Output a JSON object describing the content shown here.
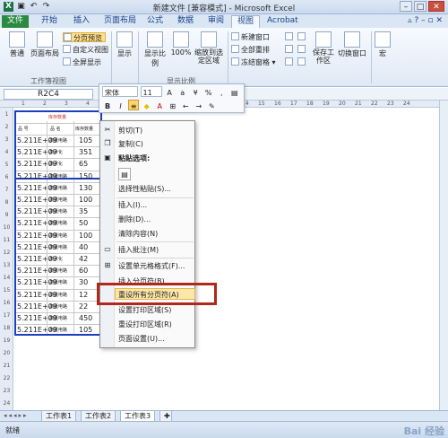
{
  "window": {
    "title": "新建文件 [兼容模式] - Microsoft Excel",
    "qat_icons": [
      "excel-logo-icon",
      "save-icon",
      "undo-icon",
      "redo-icon"
    ],
    "controls": [
      "minimize",
      "maximize",
      "close"
    ]
  },
  "ribbon_tabs": [
    "文件",
    "开始",
    "插入",
    "页面布局",
    "公式",
    "数据",
    "审阅",
    "视图",
    "Acrobat"
  ],
  "active_tab": "视图",
  "ribbon": {
    "workbook_views": {
      "normal": "普通",
      "page_layout": "页面布局",
      "page_break_preview": "分页预览",
      "custom_views": "自定义视图",
      "full_screen": "全屏显示",
      "group_label": "工作簿视图"
    },
    "show": {
      "label": "显示"
    },
    "zoom": {
      "zoom": "显示比例",
      "hundred": "100%",
      "zoom_to_selection": "缩放到选定区域",
      "group_label": "显示比例"
    },
    "window": {
      "new_window": "新建窗口",
      "arrange_all": "全部重排",
      "freeze_panes": "冻结窗格",
      "save_workspace": "保存工作区",
      "switch_windows": "切换窗口"
    },
    "macros": {
      "label": "宏"
    }
  },
  "formula_bar": {
    "name_box": "R2C4"
  },
  "mini_toolbar": {
    "font": "宋体",
    "size": "11",
    "bold": "B",
    "italic": "I",
    "percent": "%"
  },
  "context_menu": {
    "items": [
      "剪切(T)",
      "复制(C)",
      "粘贴选项:",
      "选择性粘贴(S)...",
      "插入(I)...",
      "删除(D)...",
      "清除内容(N)",
      "插入批注(M)",
      "设置单元格格式(F)...",
      "插入分页符(B)",
      "重设所有分页符(A)",
      "设置打印区域(S)",
      "重设打印区域(R)",
      "页面设置(U)..."
    ],
    "highlighted": "重设所有分页符(A)",
    "highlight_color": "#b0281c"
  },
  "sheet": {
    "column_headers": [
      "1",
      "2",
      "3",
      "4",
      "5",
      "6",
      "7",
      "8",
      "9",
      "10",
      "11",
      "12",
      "13",
      "14",
      "15",
      "16",
      "17",
      "18",
      "19",
      "20",
      "21",
      "22",
      "23",
      "24"
    ],
    "row_headers": [
      "1",
      "2",
      "3",
      "4",
      "5",
      "6",
      "7",
      "8",
      "9",
      "10",
      "11",
      "12",
      "13",
      "14",
      "15",
      "16",
      "17",
      "18",
      "19",
      "20",
      "21",
      "22",
      "23",
      "24"
    ],
    "title_cell": "库存数量",
    "header_row": [
      "品 号",
      "品 名",
      "库存数量"
    ],
    "rows": [
      [
        "5.211E+09",
        "高纸电路",
        "105"
      ],
      [
        "5.211E+09",
        "高术化",
        "351"
      ],
      [
        "5.211E+09",
        "高术化",
        "65"
      ],
      [
        "5.211E+09",
        "高纸电路",
        "150"
      ],
      [
        "5.211E+09",
        "高纸电路",
        "130"
      ],
      [
        "5.211E+09",
        "高纸电路",
        "100"
      ],
      [
        "5.211E+09",
        "高纸电路",
        "35"
      ],
      [
        "5.211E+09",
        "高纸电路",
        "50"
      ],
      [
        "5.211E+09",
        "高纸电路",
        "100"
      ],
      [
        "5.211E+09",
        "高纸电路",
        "40"
      ],
      [
        "5.211E+09",
        "高术化",
        "42"
      ],
      [
        "5.211E+09",
        "高纸电路",
        "60"
      ],
      [
        "5.211E+09",
        "高纸电路",
        "30"
      ],
      [
        "5.211E+09",
        "高纸电路",
        "12"
      ],
      [
        "5.211E+09",
        "高纸电路",
        "22"
      ],
      [
        "5.211E+09",
        "高纸电路",
        "450"
      ],
      [
        "5.211E+09",
        "高纸电路",
        "105"
      ]
    ],
    "page_break_color": "#1c3fbf"
  },
  "sheet_tabs": [
    "工作表1",
    "工作表2",
    "工作表3"
  ],
  "active_sheet": "工作表3",
  "status": {
    "ready": "就绪",
    "watermark": "Bai 经验"
  }
}
